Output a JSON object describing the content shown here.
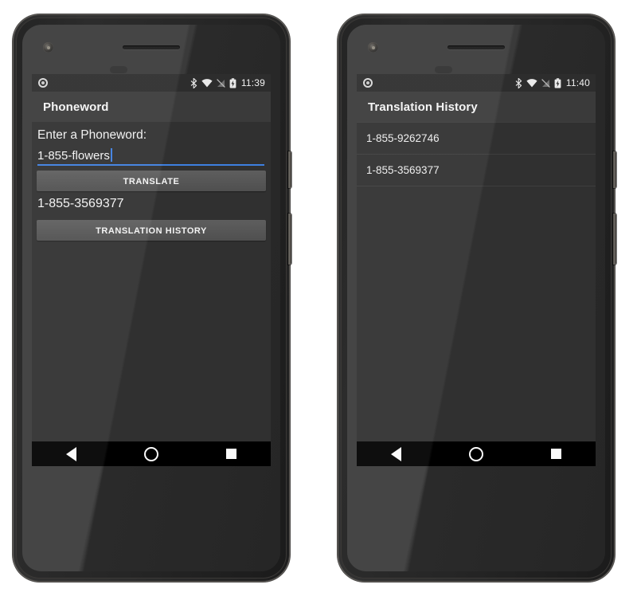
{
  "phones": [
    {
      "id": "phoneword-app",
      "statusbar": {
        "notification_icon": "circle-notification-icon",
        "bluetooth_icon": "bluetooth-icon",
        "wifi_icon": "wifi-icon",
        "signal_icon": "signal-off-icon",
        "battery_icon": "battery-charging-icon",
        "clock": "11:39"
      },
      "appbar": {
        "title": "Phoneword"
      },
      "screen": {
        "label": "Enter a Phoneword:",
        "input_value": "1-855-flowers",
        "input_placeholder": "Enter a Phoneword",
        "translate_button": "TRANSLATE",
        "result": "1-855-3569377",
        "history_button": "TRANSLATION HISTORY"
      },
      "navbar": {
        "back": "back-icon",
        "home": "home-icon",
        "recents": "recents-icon"
      }
    },
    {
      "id": "translation-history-app",
      "statusbar": {
        "notification_icon": "circle-notification-icon",
        "bluetooth_icon": "bluetooth-icon",
        "wifi_icon": "wifi-icon",
        "signal_icon": "signal-off-icon",
        "battery_icon": "battery-charging-icon",
        "clock": "11:40"
      },
      "appbar": {
        "title": "Translation History"
      },
      "screen": {
        "items": [
          {
            "number": "1-855-9262746"
          },
          {
            "number": "1-855-3569377"
          }
        ]
      },
      "navbar": {
        "back": "back-icon",
        "home": "home-icon",
        "recents": "recents-icon"
      }
    }
  ],
  "colors": {
    "accent": "#3d7fe0",
    "screen_bg": "#303030",
    "appbar_bg": "#3a3a3a",
    "statusbar_bg": "#2d2d2d",
    "button_bg": "#585858",
    "navbar_bg": "#000000",
    "text": "#f2f2f2",
    "page_bg": "#ffffff"
  }
}
